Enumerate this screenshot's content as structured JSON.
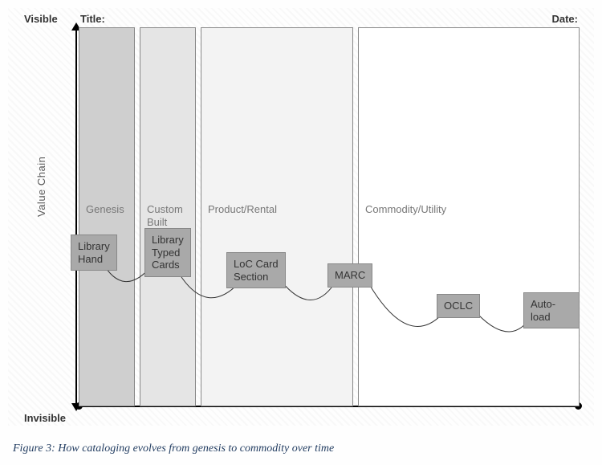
{
  "axis": {
    "top": "Visible",
    "bottom": "Invisible",
    "y": "Value Chain",
    "title": "Title:",
    "date": "Date:"
  },
  "columns": {
    "genesis": "Genesis",
    "custom": "Custom\nBuilt",
    "product": "Product/Rental",
    "commodity": "Commodity/Utility"
  },
  "nodes": {
    "library_hand": "Library\nHand",
    "library_typed": "Library\nTyped\nCards",
    "loc_card": "LoC Card\nSection",
    "marc": "MARC",
    "oclc": "OCLC",
    "autoload": "Auto-load"
  },
  "caption": "Figure 3: How cataloging evolves from genesis to commodity over time",
  "chart_data": {
    "type": "diagram",
    "axes": {
      "y_top": "Visible",
      "y_bottom": "Invisible",
      "y_label": "Value Chain",
      "x_stages": [
        "Genesis",
        "Custom Built",
        "Product/Rental",
        "Commodity/Utility"
      ]
    },
    "title_field": "Title:",
    "date_field": "Date:",
    "nodes": [
      {
        "name": "Library Hand",
        "stage": "Genesis",
        "value_chain_pct": 44
      },
      {
        "name": "Library Typed Cards",
        "stage": "Custom Built",
        "value_chain_pct": 44
      },
      {
        "name": "LoC Card Section",
        "stage": "Product/Rental",
        "value_chain_pct": 40
      },
      {
        "name": "MARC",
        "stage": "Product/Rental",
        "value_chain_pct": 38
      },
      {
        "name": "OCLC",
        "stage": "Commodity/Utility",
        "value_chain_pct": 32
      },
      {
        "name": "Auto-load",
        "stage": "Commodity/Utility",
        "value_chain_pct": 32
      }
    ],
    "edges": [
      [
        "Library Hand",
        "Library Typed Cards"
      ],
      [
        "Library Typed Cards",
        "LoC Card Section"
      ],
      [
        "LoC Card Section",
        "MARC"
      ],
      [
        "MARC",
        "OCLC"
      ],
      [
        "OCLC",
        "Auto-load"
      ]
    ],
    "caption": "Figure 3: How cataloging evolves from genesis to commodity over time"
  }
}
